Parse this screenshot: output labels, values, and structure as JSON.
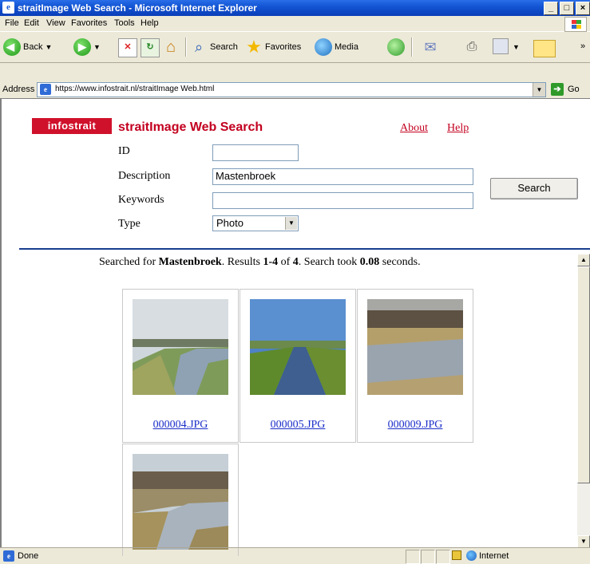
{
  "window": {
    "title": "straitImage Web Search - Microsoft Internet Explorer",
    "controls": [
      "_",
      "□",
      "×"
    ]
  },
  "menu": [
    "File",
    "Edit",
    "View",
    "Favorites",
    "Tools",
    "Help"
  ],
  "toolbar": {
    "back": "Back",
    "search": "Search",
    "favorites": "Favorites",
    "media": "Media"
  },
  "address": {
    "label": "Address",
    "url": "https://www.infostrait.nl/straitImage Web.html",
    "go": "Go"
  },
  "page": {
    "logo": "infostrait",
    "title": "straitImage Web Search",
    "links": {
      "about": "About",
      "help": "Help"
    },
    "form": {
      "id_label": "ID",
      "id_value": "",
      "description_label": "Description",
      "description_value": "Mastenbroek",
      "keywords_label": "Keywords",
      "keywords_value": "",
      "type_label": "Type",
      "type_value": "Photo",
      "search_button": "Search"
    },
    "summary": {
      "prefix": "Searched for ",
      "term": "Mastenbroek",
      "mid1": ". Results ",
      "range": "1-4",
      "mid2": " of ",
      "total": "4",
      "mid3": ". Search took ",
      "time": "0.08",
      "suffix": " seconds."
    },
    "results": [
      {
        "file": "000004.JPG"
      },
      {
        "file": "000005.JPG"
      },
      {
        "file": "000009.JPG"
      },
      {
        "file": ""
      }
    ]
  },
  "status": {
    "text": "Done",
    "zone": "Internet"
  }
}
